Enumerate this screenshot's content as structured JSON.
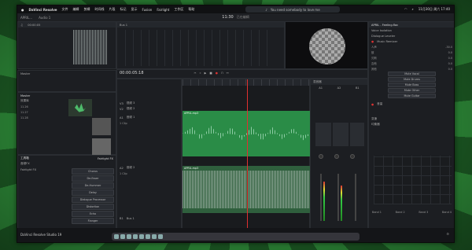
{
  "app": {
    "name": "DaVinci Resolve",
    "footer": "DaVinci Resolve Studio 19"
  },
  "menubar": {
    "items": [
      "文件",
      "编辑",
      "剪辑",
      "时间线",
      "片段",
      "标记",
      "显示",
      "Fusion",
      "Fairlight",
      "工作区",
      "帮助"
    ],
    "notification": "You need somebody to love me",
    "clock": "11月30日 周六 17:40"
  },
  "titlebar": {
    "timecode": "11:30",
    "status": "已在编辑",
    "project_tabs": [
      "APRIL...",
      "Audio 1"
    ]
  },
  "timeline": {
    "timecode": "00:00:05:18",
    "tracks": [
      {
        "id": "V3",
        "name": "视频 3"
      },
      {
        "id": "V2",
        "name": "视频 2"
      },
      {
        "id": "A1",
        "name": "音频 1",
        "clips": "1 Clip"
      },
      {
        "id": "A2",
        "name": "音频 2",
        "clips": "1 Clip"
      },
      {
        "id": "B1",
        "name": "Bus 1"
      }
    ],
    "clip_label": "APRIL.mp3"
  },
  "left": {
    "master": "Master",
    "sections": [
      "Master",
      "效果库",
      "工具箱",
      "音频FX",
      "Fairlight FX"
    ],
    "items": [
      "11.26",
      "11.27",
      "11.28"
    ],
    "fx_list": [
      "Chorus",
      "De-Esser",
      "De-Hummer",
      "Delay",
      "Dialogue Processor",
      "Distortion",
      "Echo",
      "Flanger"
    ],
    "fx_header": "Fairlight FX"
  },
  "mixer": {
    "title": "混音器",
    "channels": [
      "A1",
      "A2",
      "B1"
    ],
    "buses": [
      "Bus 1",
      "Bus 2"
    ]
  },
  "inspector": {
    "title": "APRIL - Feeling.flac",
    "sections": [
      "Voice Isolation",
      "Dialogue Leveler",
      "Music Remixer",
      "音量",
      "变速",
      "均衡器"
    ],
    "remixer": {
      "rows": [
        {
          "label": "人声",
          "value": "-30.0"
        },
        {
          "label": "鼓",
          "value": "0.0"
        },
        {
          "label": "贝斯",
          "value": "0.0"
        },
        {
          "label": "吉他",
          "value": "0.0"
        },
        {
          "label": "其他",
          "value": "0.0"
        }
      ],
      "buttons": [
        "Mute Vocal",
        "Mute Drums",
        "Mute Bass",
        "Mute Other",
        "Mute Guitar"
      ]
    },
    "eq_bands": [
      "Band 1",
      "Band 2",
      "Band 3",
      "Band 4"
    ]
  }
}
